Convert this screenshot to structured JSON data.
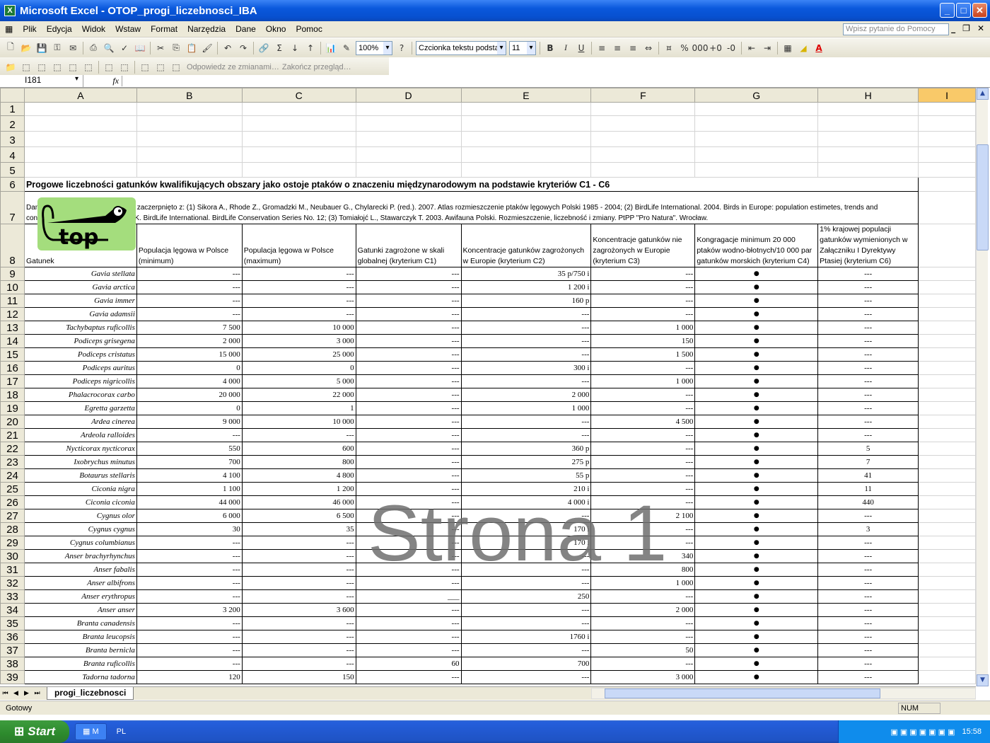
{
  "window": {
    "title": "Microsoft Excel - OTOP_progi_liczebnosci_IBA"
  },
  "menu": [
    "Plik",
    "Edycja",
    "Widok",
    "Wstaw",
    "Format",
    "Narzędzia",
    "Dane",
    "Okno",
    "Pomoc"
  ],
  "help_placeholder": "Wpisz pytanie do Pomocy",
  "toolbar": {
    "zoom": "100%",
    "font": "Czcionka tekstu podsta",
    "font_size": "11",
    "reply_changes": "Odpowiedz ze zmianami…",
    "end_review": "Zakończ przegląd…"
  },
  "formula_bar": {
    "name_box": "I181",
    "fx": "fx",
    "value": ""
  },
  "columns": [
    "A",
    "B",
    "C",
    "D",
    "E",
    "F",
    "G",
    "H",
    "I"
  ],
  "sheet": {
    "title": "Progowe liczebności gatunków kwalifikujących obszary jako ostoje ptaków o znaczeniu międzynarodowym na podstawie kryteriów C1 - C6",
    "sources": "Dane o wielkości populacji lęgowej zaczerpnięto z: (1) Sikora A., Rhode Z., Gromadzki M., Neubauer G., Chylarecki P. (red.). 2007. Atlas rozmieszczenie ptaków lęgowych Polski 1985 - 2004; (2) BirdLife International. 2004. Birds in Europe: population estimetes, trends and conservation status. Cambridge, UK. BirdLife International. BirdLife Conservation Series No. 12; (3) Tomiałojć L., Stawarczyk T. 2003. Awifauna Polski. Rozmieszczenie, liczebność i zmiany. PtPP \"Pro Natura\". Wrocław.",
    "headers": [
      "Gatunek",
      "Populacja lęgowa w Polsce (minimum)",
      "Populacja lęgowa w Polsce (maximum)",
      "Gatunki zagrożone w skali globalnej (kryterium C1)",
      "Koncentracje gatunków zagrożonych w Europie (kryterium C2)",
      "Koncentracje gatunków nie zagrożonych w Europie (kryterium C3)",
      "Kongragacje minimum 20 000 ptaków wodno-błotnych/10 000 par gatunków morskich (kryterium C4)",
      "1% krajowej populacji gatunków wymienionych w Załączniku I Dyrektywy Ptasiej (kryterium C6)"
    ],
    "rows": [
      [
        "Gavia stellata",
        "---",
        "---",
        "---",
        "35 p/750 i",
        "---",
        "●",
        "---"
      ],
      [
        "Gavia arctica",
        "---",
        "---",
        "---",
        "1 200 i",
        "---",
        "●",
        "---"
      ],
      [
        "Gavia immer",
        "---",
        "---",
        "---",
        "160 p",
        "---",
        "●",
        "---"
      ],
      [
        "Gavia adamsii",
        "---",
        "---",
        "---",
        "---",
        "---",
        "●",
        "---"
      ],
      [
        "Tachybaptus ruficollis",
        "7 500",
        "10 000",
        "---",
        "---",
        "1 000",
        "●",
        "---"
      ],
      [
        "Podiceps grisegena",
        "2 000",
        "3 000",
        "---",
        "---",
        "150",
        "●",
        "---"
      ],
      [
        "Podiceps cristatus",
        "15 000",
        "25 000",
        "---",
        "---",
        "1 500",
        "●",
        "---"
      ],
      [
        "Podiceps auritus",
        "0",
        "0",
        "---",
        "300 i",
        "---",
        "●",
        "---"
      ],
      [
        "Podiceps nigricollis",
        "4 000",
        "5 000",
        "---",
        "---",
        "1 000",
        "●",
        "---"
      ],
      [
        "Phalacrocorax carbo",
        "20 000",
        "22 000",
        "---",
        "2 000",
        "---",
        "●",
        "---"
      ],
      [
        "Egretta garzetta",
        "0",
        "1",
        "---",
        "1 000",
        "---",
        "●",
        "---"
      ],
      [
        "Ardea cinerea",
        "9 000",
        "10 000",
        "---",
        "---",
        "4 500",
        "●",
        "---"
      ],
      [
        "Ardeola ralloides",
        "---",
        "---",
        "---",
        "---",
        "---",
        "●",
        "---"
      ],
      [
        "Nycticorax nycticorax",
        "550",
        "600",
        "---",
        "360 p",
        "---",
        "●",
        "5"
      ],
      [
        "Ixobrychus minutus",
        "700",
        "800",
        "---",
        "275 p",
        "---",
        "●",
        "7"
      ],
      [
        "Botaurus stellaris",
        "4 100",
        "4 800",
        "---",
        "55 p",
        "---",
        "●",
        "41"
      ],
      [
        "Ciconia nigra",
        "1 100",
        "1 200",
        "---",
        "210 i",
        "---",
        "●",
        "11"
      ],
      [
        "Ciconia ciconia",
        "44 000",
        "46 000",
        "---",
        "4 000 i",
        "---",
        "●",
        "440"
      ],
      [
        "Cygnus olor",
        "6 000",
        "6 500",
        "---",
        "---",
        "2 100",
        "●",
        "---"
      ],
      [
        "Cygnus cygnus",
        "30",
        "35",
        "---",
        "170 i",
        "---",
        "●",
        "3"
      ],
      [
        "Cygnus columbianus",
        "---",
        "---",
        "---",
        "170 i",
        "---",
        "●",
        "---"
      ],
      [
        "Anser brachyrhynchus",
        "---",
        "---",
        "---",
        "---",
        "340",
        "●",
        "---"
      ],
      [
        "Anser fabalis",
        "---",
        "---",
        "---",
        "---",
        "800",
        "●",
        "---"
      ],
      [
        "Anser albifrons",
        "---",
        "---",
        "---",
        "---",
        "1 000",
        "●",
        "---"
      ],
      [
        "Anser erythropus",
        "---",
        "---",
        "___",
        "250",
        "---",
        "●",
        "---"
      ],
      [
        "Anser anser",
        "3 200",
        "3 600",
        "---",
        "---",
        "2 000",
        "●",
        "---"
      ],
      [
        "Branta canadensis",
        "---",
        "---",
        "---",
        "---",
        "---",
        "●",
        "---"
      ],
      [
        "Branta leucopsis",
        "---",
        "---",
        "---",
        "1760 i",
        "---",
        "●",
        "---"
      ],
      [
        "Branta bernicla",
        "---",
        "---",
        "---",
        "---",
        "50",
        "●",
        "---"
      ],
      [
        "Branta ruficollis",
        "---",
        "---",
        "60",
        "700",
        "---",
        "●",
        "---"
      ],
      [
        "Tadorna tadorna",
        "120",
        "150",
        "---",
        "---",
        "3 000",
        "●",
        "---"
      ]
    ]
  },
  "watermark": "Strona 1",
  "sheet_tab": "progi_liczebnosci",
  "status": {
    "left": "Gotowy",
    "num": "NUM"
  },
  "taskbar": {
    "start": "Start",
    "excel_btn": "M",
    "lang": "PL",
    "clock": "15:58"
  }
}
